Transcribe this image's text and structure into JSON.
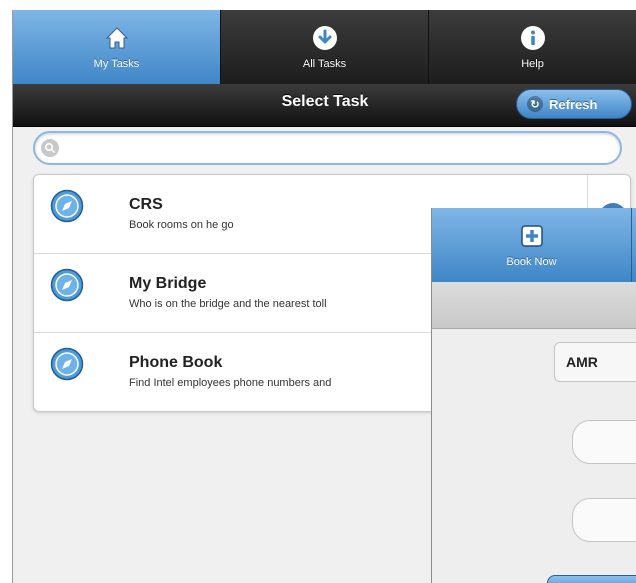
{
  "nav": {
    "tabs": [
      {
        "label": "My Tasks",
        "icon": "home-icon",
        "active": true
      },
      {
        "label": "All Tasks",
        "icon": "download-icon",
        "active": false
      },
      {
        "label": "Help",
        "icon": "info-icon",
        "active": false
      }
    ]
  },
  "header": {
    "title": "Select Task",
    "refresh_label": "Refresh"
  },
  "search": {
    "placeholder": ""
  },
  "tasks": [
    {
      "title": "CRS",
      "description": "Book rooms on he go"
    },
    {
      "title": "My Bridge",
      "description": "Who is on the bridge and the nearest toll"
    },
    {
      "title": "Phone Book",
      "description": "Find Intel employees phone numbers and"
    }
  ],
  "overlay": {
    "tab_label": "Book Now",
    "select_value": "AMR"
  },
  "colors": {
    "accent": "#4a90d0",
    "navbar": "#2a2a2a",
    "background": "#f0f0f0"
  }
}
